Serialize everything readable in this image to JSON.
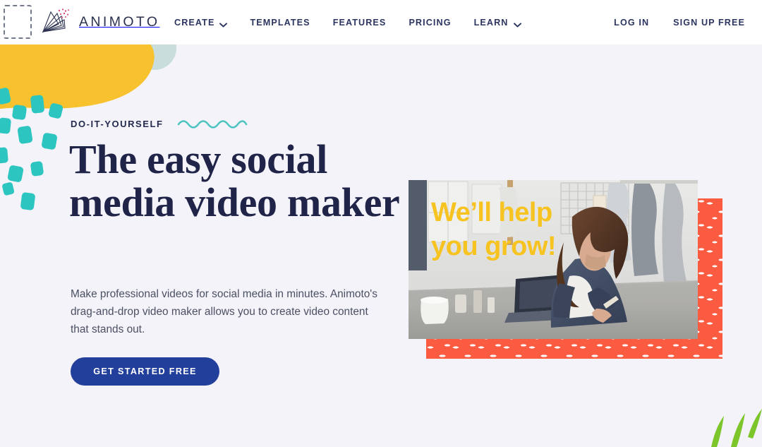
{
  "brand": {
    "name": "ANIMOTO",
    "logo_icon": "animoto-fan-logo-icon"
  },
  "colors": {
    "page_background": "#f4f3f9",
    "nav_background": "#ffffff",
    "nav_text": "#2b3560",
    "headline": "#202448",
    "cta_background": "#22409b",
    "cta_text": "#ffffff",
    "accent_yellow": "#f6c320",
    "accent_blob_yellow": "#f7c22e",
    "accent_teal": "#2cc5c0",
    "accent_coral": "#fa5b41",
    "accent_green": "#7cc62b",
    "eyebrow_text": "#232a4d",
    "body_text": "#4a4f63"
  },
  "nav": {
    "links": [
      {
        "label": "CREATE",
        "has_dropdown": true,
        "icon": "chevron-down-icon"
      },
      {
        "label": "TEMPLATES",
        "has_dropdown": false
      },
      {
        "label": "FEATURES",
        "has_dropdown": false
      },
      {
        "label": "PRICING",
        "has_dropdown": false
      },
      {
        "label": "LEARN",
        "has_dropdown": true,
        "icon": "chevron-down-icon"
      }
    ],
    "login_label": "LOG IN",
    "signup_label": "SIGN UP FREE"
  },
  "hero": {
    "eyebrow": "DO-IT-YOURSELF",
    "squiggle_icon": "wavy-line-icon",
    "headline": "The easy social media video maker",
    "subcopy": "Make professional videos for social media in minutes. Animoto's drag-and-drop video maker allows you to create video content that stands out.",
    "cta_label": "GET STARTED FREE",
    "media": {
      "overlay_text": "We’ll help you grow!",
      "photo_alt": "woman-at-desk-with-laptop-photo",
      "decor": "coral-speckled-panel"
    }
  },
  "decorations": {
    "yellow_blob": "yellow-organic-blob-shape",
    "teal_circle": "teal-circle-shape",
    "teal_confetti": "teal-confetti-dashes",
    "green_leaves": "green-leaf-strokes",
    "focus_box": "dashed-focus-outline"
  }
}
